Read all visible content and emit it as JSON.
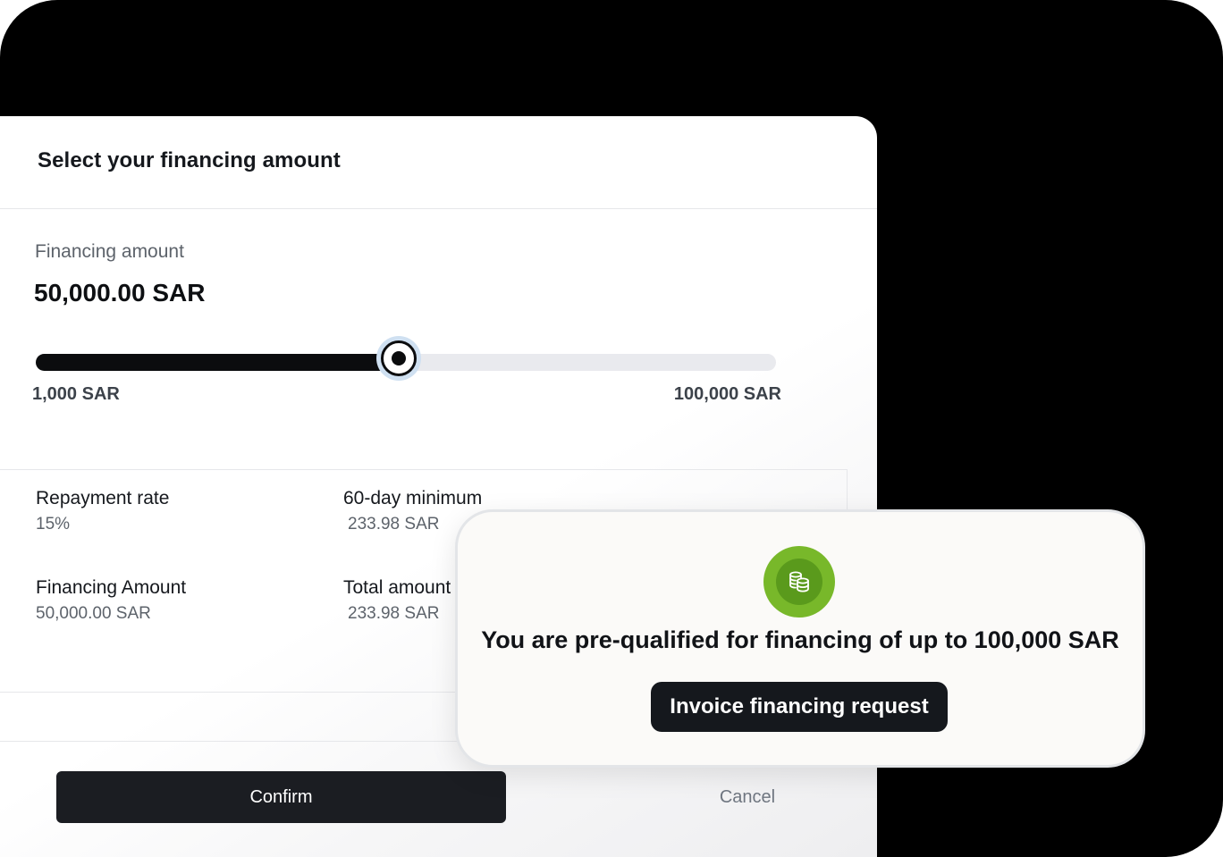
{
  "colors": {
    "background": "#000000",
    "primary_button": "#1b1d22",
    "slider_fill": "#0b0c0e",
    "badge": "#78b82a"
  },
  "panel": {
    "title": "Select your financing amount",
    "amount_label": "Financing amount",
    "amount_value": "50,000.00 SAR",
    "slider": {
      "min_label": "1,000 SAR",
      "max_label": "100,000 SAR",
      "fill_fraction": 0.49
    },
    "details": [
      {
        "label": "Repayment rate",
        "value": "15%"
      },
      {
        "label": "60-day minimum",
        "value": "233.98 SAR"
      },
      {
        "label": "Financing Amount",
        "value": "50,000.00 SAR"
      },
      {
        "label": "Total amount",
        "value": "233.98 SAR"
      }
    ],
    "confirm_label": "Confirm",
    "cancel_label": "Cancel"
  },
  "card": {
    "icon": "coins-icon",
    "message": "You are pre-qualified for financing of up to 100,000 SAR",
    "button_label": "Invoice financing request"
  }
}
